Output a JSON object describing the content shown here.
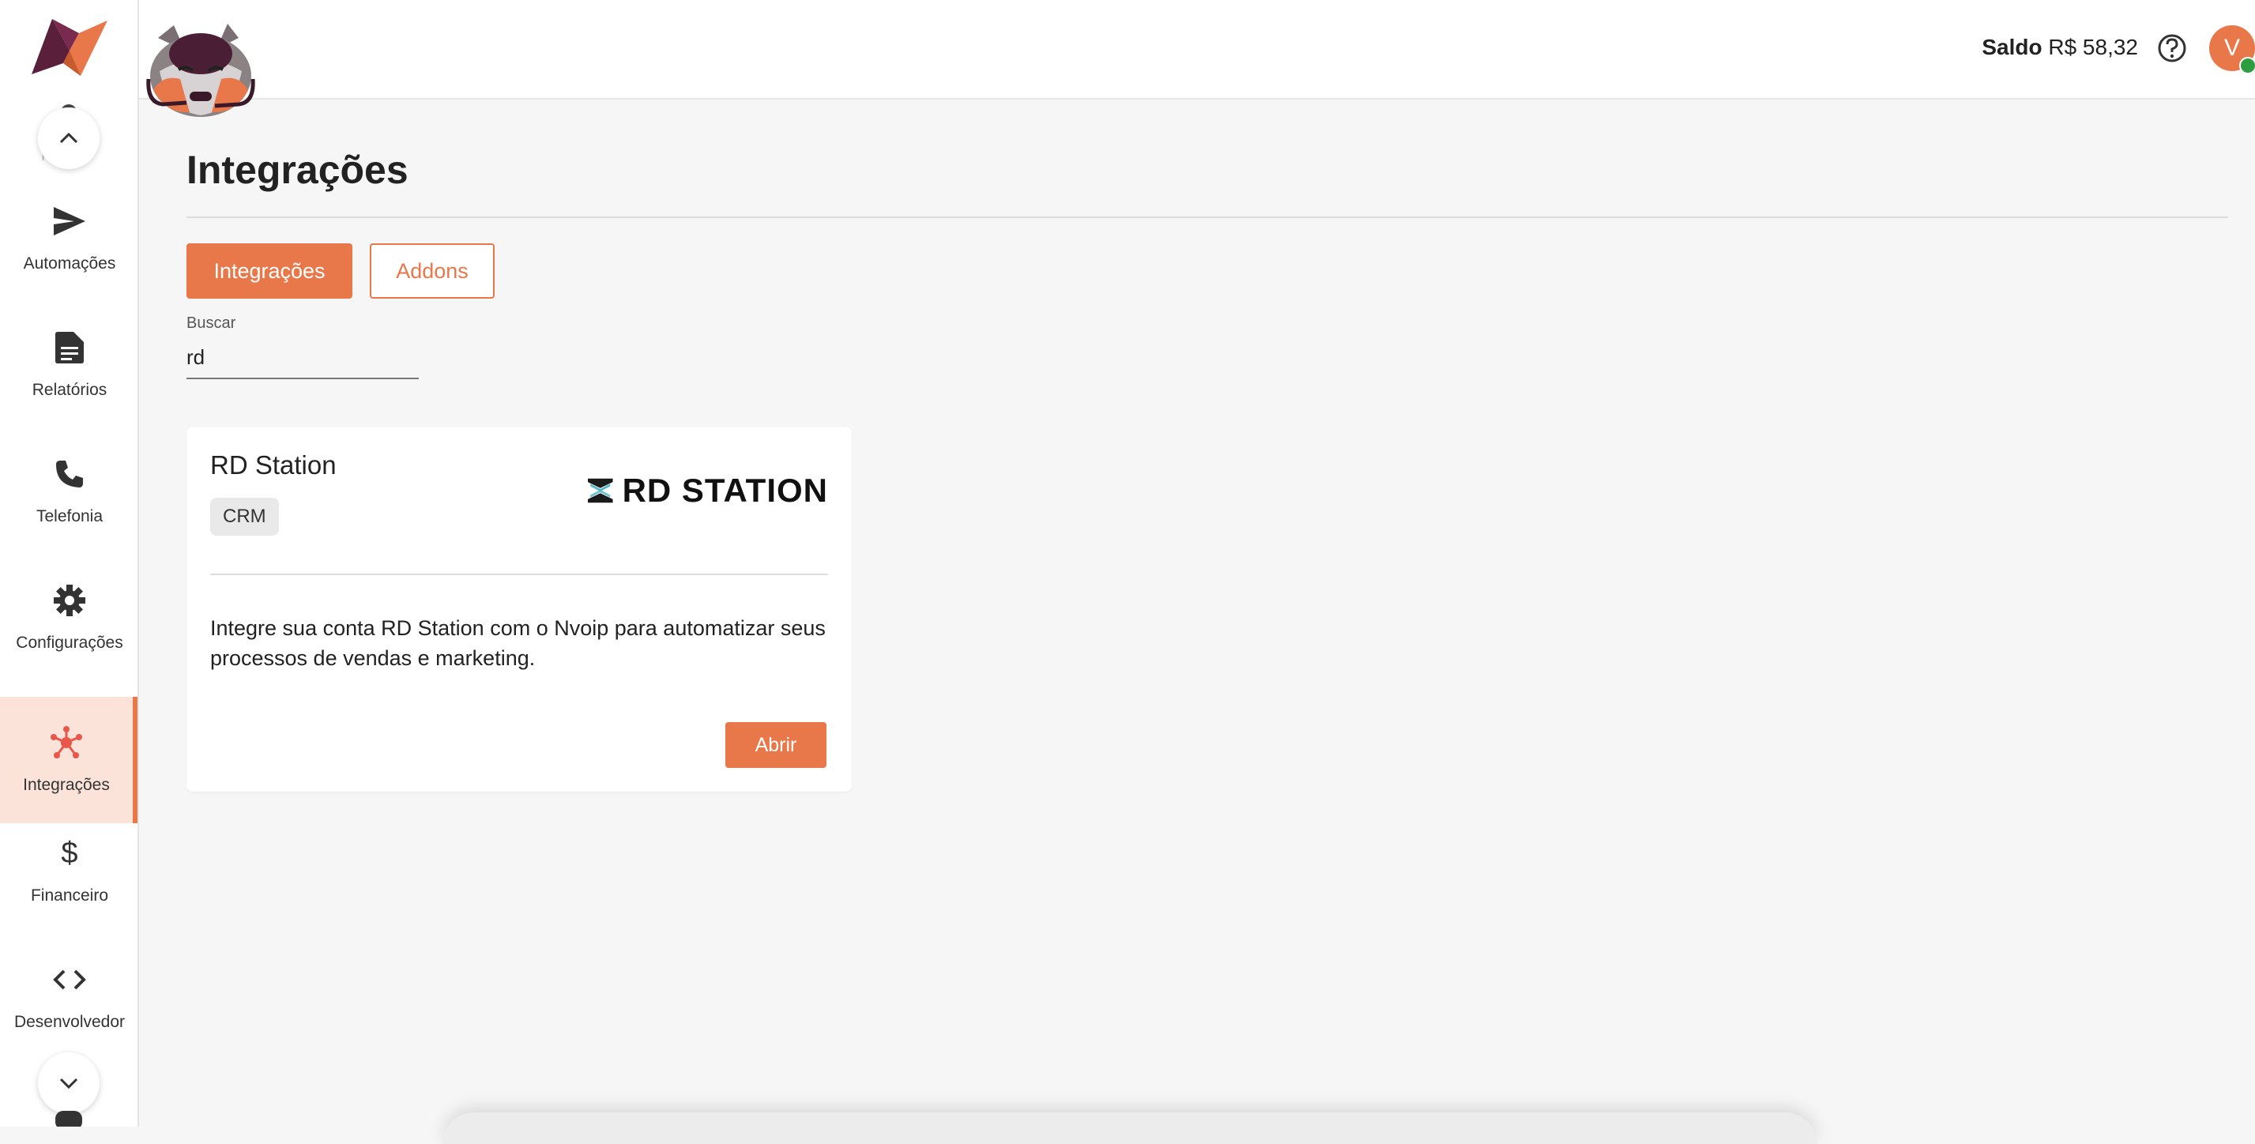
{
  "sidebar": {
    "partial_top_label": "Fórum",
    "items": [
      {
        "label": "Automações",
        "icon": "send-icon"
      },
      {
        "label": "Relatórios",
        "icon": "document-icon"
      },
      {
        "label": "Telefonia",
        "icon": "phone-icon"
      },
      {
        "label": "Configurações",
        "icon": "gear-icon"
      },
      {
        "label": "Integrações",
        "icon": "hub-icon",
        "active": true
      },
      {
        "label": "Financeiro",
        "icon": "dollar-icon"
      },
      {
        "label": "Desenvolvedor",
        "icon": "code-icon"
      }
    ]
  },
  "header": {
    "balance_label": "Saldo",
    "balance_value": "R$ 58,32",
    "avatar_initial": "V"
  },
  "main": {
    "title": "Integrações",
    "tabs": [
      {
        "label": "Integrações",
        "active": true
      },
      {
        "label": "Addons",
        "active": false
      }
    ],
    "search": {
      "label": "Buscar",
      "value": "rd"
    },
    "card": {
      "title": "RD Station",
      "chip": "CRM",
      "logo_text": "RD STATION",
      "description": "Integre sua conta RD Station com o Nvoip para automatizar seus processos de vendas e marketing.",
      "button_label": "Abrir"
    }
  },
  "colors": {
    "accent": "#e8774a",
    "active_bg": "#fbe3da",
    "status_online": "#2e9d3f"
  }
}
